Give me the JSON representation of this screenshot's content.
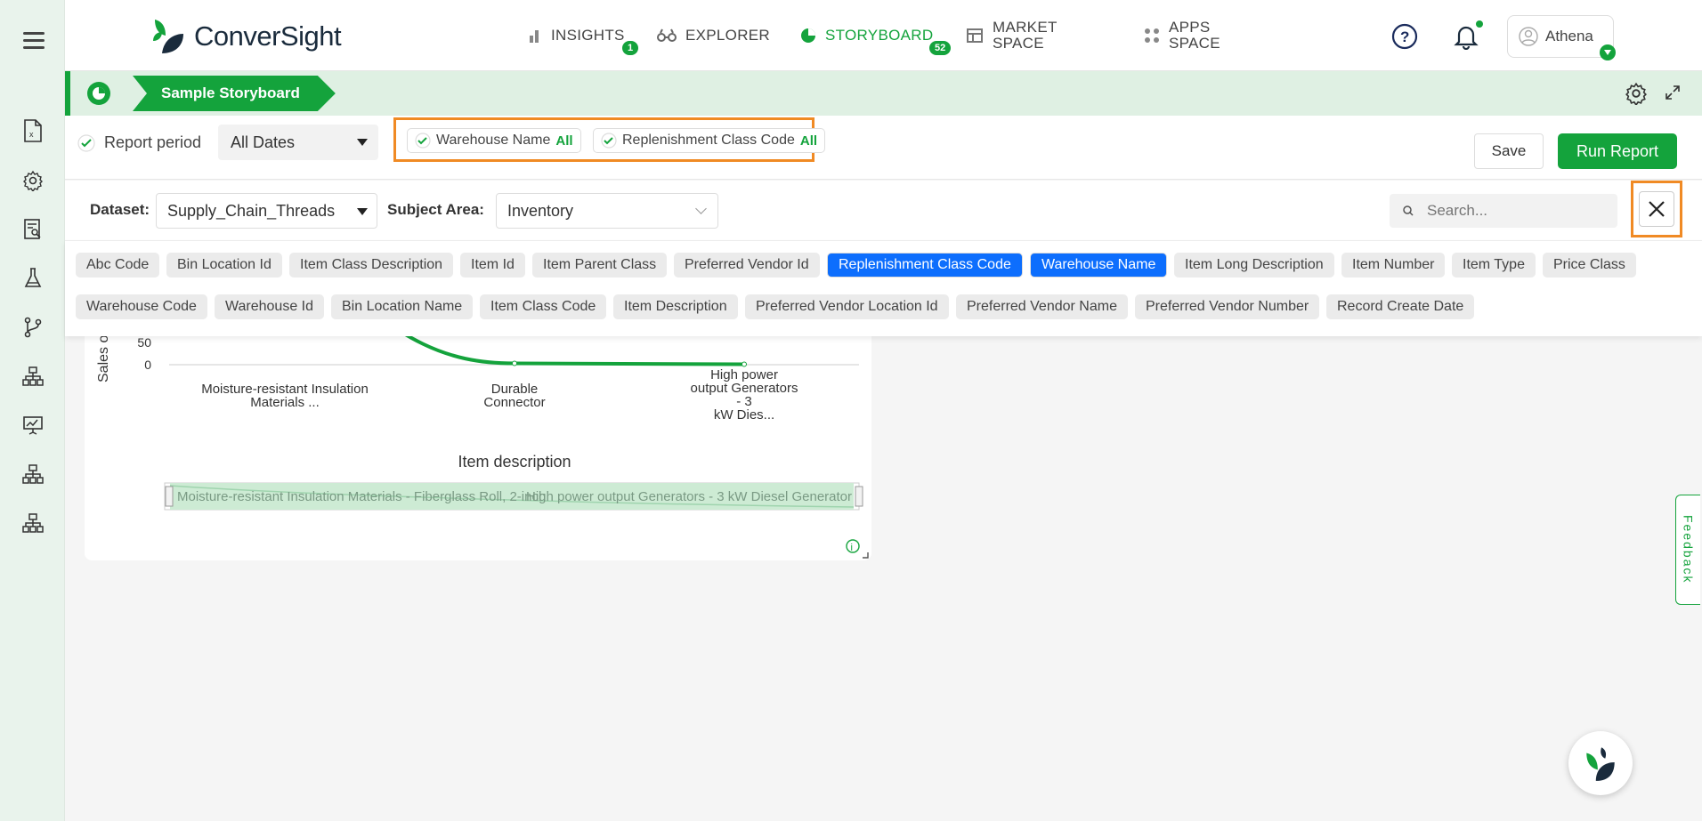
{
  "app": {
    "brand": "ConverSight",
    "accent": "#14a33c",
    "selected_chip_color": "#0d6efd",
    "highlight_color": "#f08a24"
  },
  "nav": {
    "insights": {
      "label": "INSIGHTS",
      "badge": "1"
    },
    "explorer": {
      "label": "EXPLORER"
    },
    "storyboard": {
      "label": "STORYBOARD",
      "badge": "52"
    },
    "market_l1": "MARKET",
    "market_l2": "SPACE",
    "apps_l1": "APPS",
    "apps_l2": "SPACE",
    "user": "Athena"
  },
  "storyboard": {
    "tab": "Sample Storyboard"
  },
  "filters": {
    "report_period_label": "Report period",
    "report_period_value": "All Dates",
    "warehouse": {
      "label": "Warehouse Name",
      "value": "All"
    },
    "replenishment": {
      "label": "Replenishment Class Code",
      "value": "All"
    },
    "save": "Save",
    "run": "Run Report"
  },
  "dataset": {
    "dataset_label": "Dataset:",
    "dataset_value": "Supply_Chain_Threads",
    "subject_label": "Subject Area:",
    "subject_value": "Inventory",
    "search_placeholder": "Search..."
  },
  "columns": {
    "row1": [
      "Abc Code",
      "Bin Location Id",
      "Item Class Description",
      "Item Id",
      "Item Parent Class",
      "Preferred Vendor Id",
      "Replenishment Class Code",
      "Warehouse Name",
      "Item Long Description",
      "Item Number",
      "Item Type",
      "Price Class"
    ],
    "row2": [
      "Warehouse Code",
      "Warehouse Id",
      "Bin Location Name",
      "Item Class Code",
      "Item Description",
      "Preferred Vendor Location Id",
      "Preferred Vendor Name",
      "Preferred Vendor Number",
      "Record Create Date"
    ],
    "selected": [
      "Replenishment Class Code",
      "Warehouse Name"
    ]
  },
  "chart_data": {
    "type": "line",
    "xlabel": "Item description",
    "ylabel": "Sales o",
    "yticks": [
      "50",
      "0"
    ],
    "categories": [
      "Moisture-resistant Insulation Materials ...",
      "Durable Connector",
      "High power output Generators - 3 kW Dies..."
    ],
    "values": [
      60,
      3,
      1
    ],
    "slider_text_1": "Moisture-resistant Insulation Materials - Fiberglass Roll, 2-inch",
    "slider_text_2": "High power output Generators - 3 kW Diesel Generator",
    "line_color": "#14a33c"
  },
  "feedback": "Feedback"
}
